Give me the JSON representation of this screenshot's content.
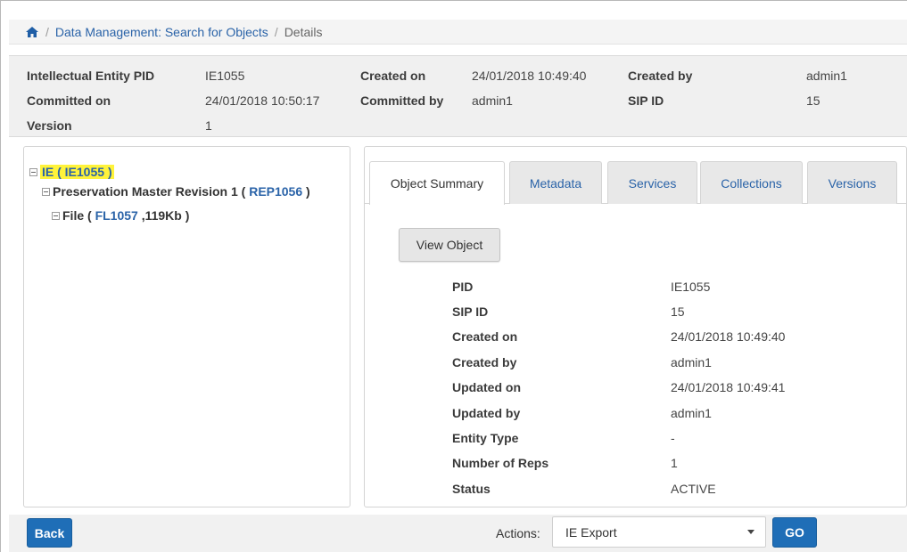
{
  "breadcrumb": {
    "home_icon": "home-icon",
    "items": [
      "Data Management: Search for Objects",
      "Details"
    ]
  },
  "header": {
    "ie_pid_label": "Intellectual Entity PID",
    "ie_pid_value": "IE1055",
    "created_on_label": "Created on",
    "created_on_value": "24/01/2018 10:49:40",
    "created_by_label": "Created by",
    "created_by_value": "admin1",
    "committed_on_label": "Committed on",
    "committed_on_value": "24/01/2018 10:50:17",
    "committed_by_label": "Committed by",
    "committed_by_value": "admin1",
    "sip_id_label": "SIP ID",
    "sip_id_value": "15",
    "version_label": "Version",
    "version_value": "1"
  },
  "tree": {
    "root_prefix": "IE (",
    "root_link": "IE1055",
    "root_suffix": ")",
    "rep_prefix": "Preservation Master Revision 1 (",
    "rep_link": "REP1056",
    "rep_suffix": ")",
    "file_prefix": "File (",
    "file_link": "FL1057",
    "file_suffix": ",119Kb )"
  },
  "tabs": [
    "Object Summary",
    "Metadata",
    "Services",
    "Collections",
    "Versions"
  ],
  "view_object_label": "View Object",
  "summary": [
    {
      "label": "PID",
      "value": "IE1055"
    },
    {
      "label": "SIP ID",
      "value": "15"
    },
    {
      "label": "Created on",
      "value": "24/01/2018 10:49:40"
    },
    {
      "label": "Created by",
      "value": "admin1"
    },
    {
      "label": "Updated on",
      "value": "24/01/2018 10:49:41"
    },
    {
      "label": "Updated by",
      "value": "admin1"
    },
    {
      "label": "Entity Type",
      "value": "-"
    },
    {
      "label": "Number of Reps",
      "value": "1"
    },
    {
      "label": "Status",
      "value": "ACTIVE"
    }
  ],
  "footer": {
    "back_label": "Back",
    "actions_label": "Actions:",
    "select_value": "IE Export",
    "go_label": "GO"
  },
  "colors": {
    "link": "#2a63a8",
    "primary_button": "#1f6eb7",
    "highlight": "#fff33a"
  }
}
